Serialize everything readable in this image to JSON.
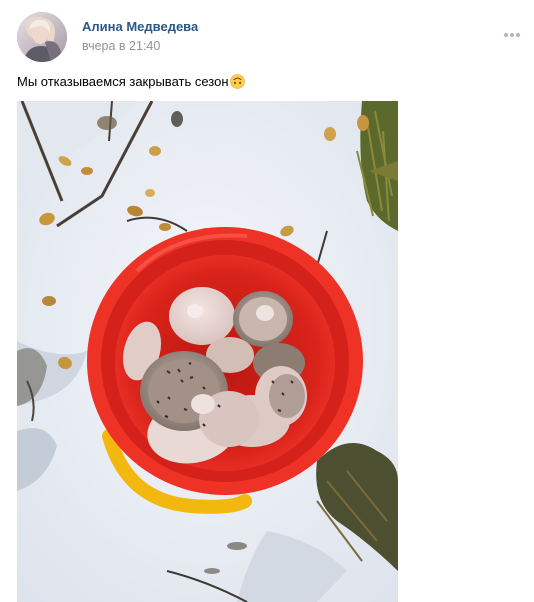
{
  "post": {
    "author": "Алина Медведева",
    "time": "вчера в 21:40",
    "text": "Мы отказываемся закрывать сезон",
    "emoji": "upside-down-face-emoji",
    "colors": {
      "author_link": "#2a5885",
      "meta_gray": "#939393",
      "bucket_red": "#e3241b",
      "bucket_handle": "#f1b90e",
      "snow": "#eef1f6"
    }
  },
  "icons": {
    "more": "more-dots-icon"
  }
}
